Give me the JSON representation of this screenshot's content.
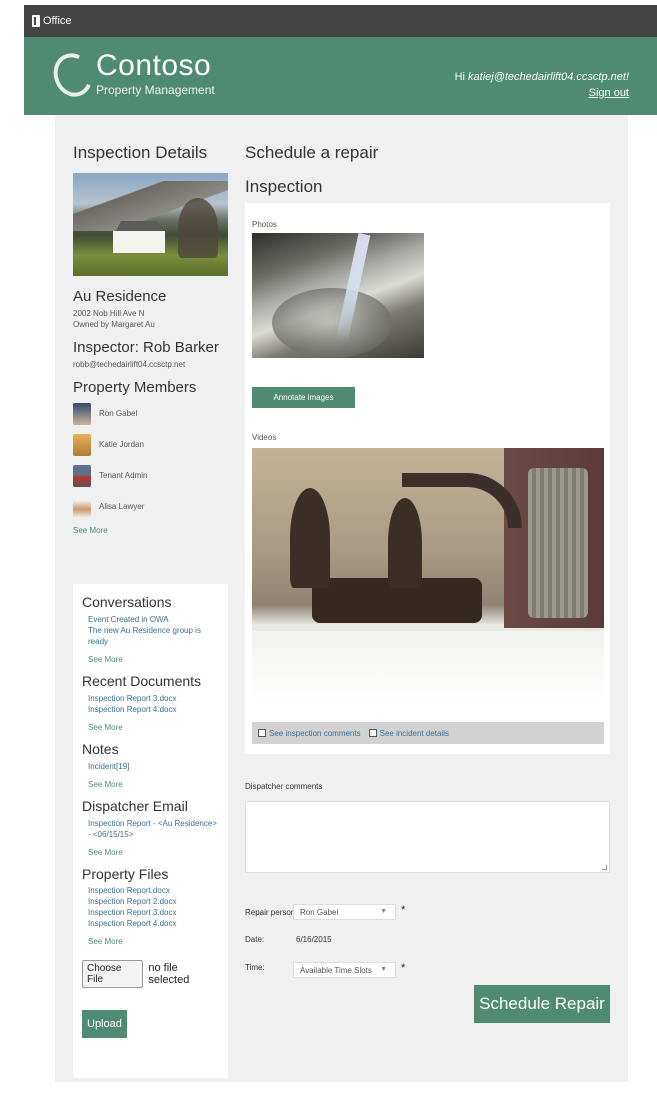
{
  "office_bar": {
    "label": "Office",
    "icon": "office-logo-icon"
  },
  "header": {
    "brand": "Contoso",
    "brand_sub": "Property Management",
    "greeting_prefix": "Hi ",
    "user_email": "katiej@techedairlift04.ccsctp.net!",
    "sign_out": "Sign out",
    "color": "#4f8a72"
  },
  "left": {
    "section_title": "Inspection Details",
    "property_name": "Au Residence",
    "address": "2002 Nob Hill Ave N",
    "owner": "Owned by Margaret Au",
    "inspector_title": "Inspector: Rob Barker",
    "inspector_email": "robb@techedairlift04.ccsctp.net",
    "members_title": "Property Members",
    "members": [
      {
        "name": "Ron Gabel"
      },
      {
        "name": "Katie Jordan"
      },
      {
        "name": "Tenant Admin"
      },
      {
        "name": "Alisa Lawyer"
      }
    ],
    "see_more": "See More"
  },
  "panel": {
    "conversations_title": "Conversations",
    "conversations": [
      "Event Created in OWA",
      "The new Au Residence group is ready"
    ],
    "documents_title": "Recent Documents",
    "documents": [
      "Inspection Report 3.docx",
      "Inspection Report 4.docx"
    ],
    "notes_title": "Notes",
    "notes": [
      "Incident[19]"
    ],
    "email_title": "Dispatcher Email",
    "email_items": [
      "Inspection Report - <Au Residence> - <06/15/15>"
    ],
    "files_title": "Property Files",
    "files": [
      "Inspection Report.docx",
      "Inspection Report 2.docx",
      "Inspection Report 3.docx",
      "Inspection Report 4.docx"
    ],
    "see_more": "See More",
    "choose_file": "Choose File",
    "no_file": "no file selected",
    "upload": "Upload"
  },
  "main": {
    "page_title": "Schedule a repair",
    "inspection_title": "Inspection",
    "photos_label": "Photos",
    "annotate_button": "Annotate images",
    "videos_label": "Videos",
    "see_inspection_comments": "See inspection comments",
    "see_incident_details": "See incident details",
    "dispatcher_comments_label": "Dispatcher comments",
    "dispatcher_comments_value": "",
    "repair_person_label": "Repair person:",
    "repair_person_value": "Ron Gabel",
    "date_label": "Date:",
    "date_value": "6/16/2015",
    "time_label": "Time:",
    "time_value": "Available Time Slots",
    "required_mark": "*",
    "schedule_button": "Schedule Repair"
  }
}
